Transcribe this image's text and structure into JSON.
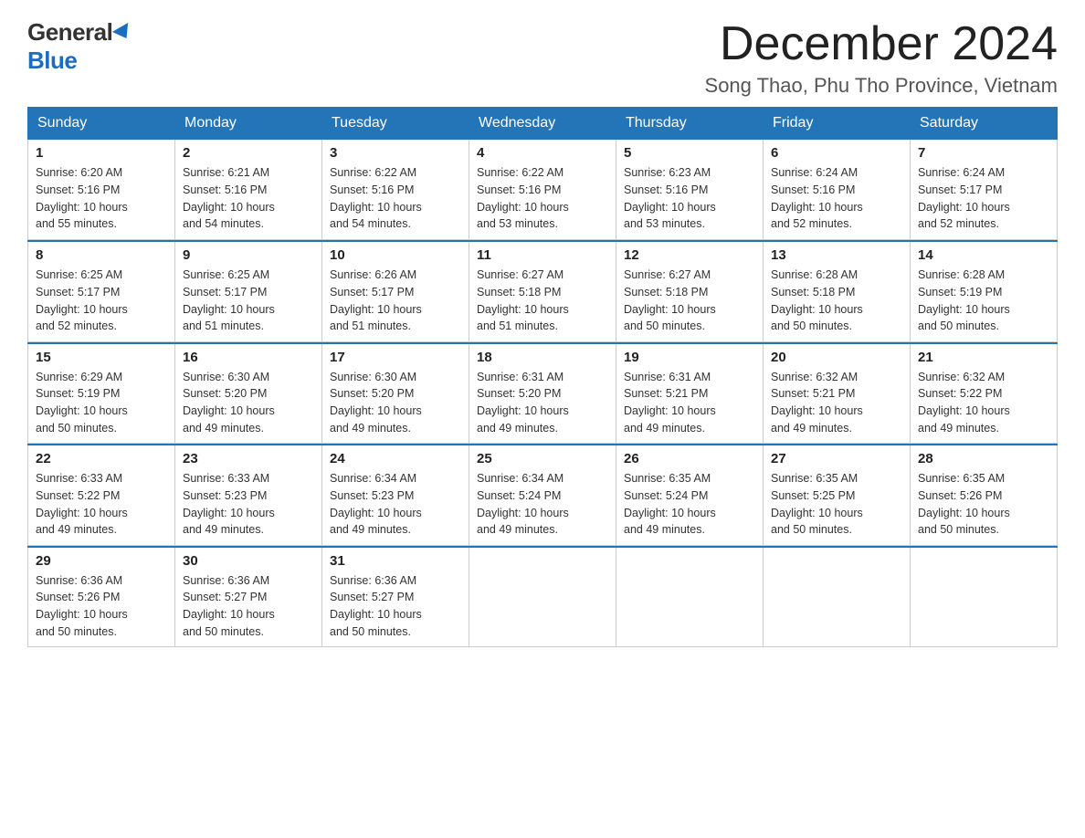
{
  "logo": {
    "general": "General",
    "blue": "Blue"
  },
  "title": "December 2024",
  "subtitle": "Song Thao, Phu Tho Province, Vietnam",
  "weekdays": [
    "Sunday",
    "Monday",
    "Tuesday",
    "Wednesday",
    "Thursday",
    "Friday",
    "Saturday"
  ],
  "weeks": [
    [
      {
        "day": "1",
        "sunrise": "Sunrise: 6:20 AM",
        "sunset": "Sunset: 5:16 PM",
        "daylight": "Daylight: 10 hours",
        "daylight2": "and 55 minutes."
      },
      {
        "day": "2",
        "sunrise": "Sunrise: 6:21 AM",
        "sunset": "Sunset: 5:16 PM",
        "daylight": "Daylight: 10 hours",
        "daylight2": "and 54 minutes."
      },
      {
        "day": "3",
        "sunrise": "Sunrise: 6:22 AM",
        "sunset": "Sunset: 5:16 PM",
        "daylight": "Daylight: 10 hours",
        "daylight2": "and 54 minutes."
      },
      {
        "day": "4",
        "sunrise": "Sunrise: 6:22 AM",
        "sunset": "Sunset: 5:16 PM",
        "daylight": "Daylight: 10 hours",
        "daylight2": "and 53 minutes."
      },
      {
        "day": "5",
        "sunrise": "Sunrise: 6:23 AM",
        "sunset": "Sunset: 5:16 PM",
        "daylight": "Daylight: 10 hours",
        "daylight2": "and 53 minutes."
      },
      {
        "day": "6",
        "sunrise": "Sunrise: 6:24 AM",
        "sunset": "Sunset: 5:16 PM",
        "daylight": "Daylight: 10 hours",
        "daylight2": "and 52 minutes."
      },
      {
        "day": "7",
        "sunrise": "Sunrise: 6:24 AM",
        "sunset": "Sunset: 5:17 PM",
        "daylight": "Daylight: 10 hours",
        "daylight2": "and 52 minutes."
      }
    ],
    [
      {
        "day": "8",
        "sunrise": "Sunrise: 6:25 AM",
        "sunset": "Sunset: 5:17 PM",
        "daylight": "Daylight: 10 hours",
        "daylight2": "and 52 minutes."
      },
      {
        "day": "9",
        "sunrise": "Sunrise: 6:25 AM",
        "sunset": "Sunset: 5:17 PM",
        "daylight": "Daylight: 10 hours",
        "daylight2": "and 51 minutes."
      },
      {
        "day": "10",
        "sunrise": "Sunrise: 6:26 AM",
        "sunset": "Sunset: 5:17 PM",
        "daylight": "Daylight: 10 hours",
        "daylight2": "and 51 minutes."
      },
      {
        "day": "11",
        "sunrise": "Sunrise: 6:27 AM",
        "sunset": "Sunset: 5:18 PM",
        "daylight": "Daylight: 10 hours",
        "daylight2": "and 51 minutes."
      },
      {
        "day": "12",
        "sunrise": "Sunrise: 6:27 AM",
        "sunset": "Sunset: 5:18 PM",
        "daylight": "Daylight: 10 hours",
        "daylight2": "and 50 minutes."
      },
      {
        "day": "13",
        "sunrise": "Sunrise: 6:28 AM",
        "sunset": "Sunset: 5:18 PM",
        "daylight": "Daylight: 10 hours",
        "daylight2": "and 50 minutes."
      },
      {
        "day": "14",
        "sunrise": "Sunrise: 6:28 AM",
        "sunset": "Sunset: 5:19 PM",
        "daylight": "Daylight: 10 hours",
        "daylight2": "and 50 minutes."
      }
    ],
    [
      {
        "day": "15",
        "sunrise": "Sunrise: 6:29 AM",
        "sunset": "Sunset: 5:19 PM",
        "daylight": "Daylight: 10 hours",
        "daylight2": "and 50 minutes."
      },
      {
        "day": "16",
        "sunrise": "Sunrise: 6:30 AM",
        "sunset": "Sunset: 5:20 PM",
        "daylight": "Daylight: 10 hours",
        "daylight2": "and 49 minutes."
      },
      {
        "day": "17",
        "sunrise": "Sunrise: 6:30 AM",
        "sunset": "Sunset: 5:20 PM",
        "daylight": "Daylight: 10 hours",
        "daylight2": "and 49 minutes."
      },
      {
        "day": "18",
        "sunrise": "Sunrise: 6:31 AM",
        "sunset": "Sunset: 5:20 PM",
        "daylight": "Daylight: 10 hours",
        "daylight2": "and 49 minutes."
      },
      {
        "day": "19",
        "sunrise": "Sunrise: 6:31 AM",
        "sunset": "Sunset: 5:21 PM",
        "daylight": "Daylight: 10 hours",
        "daylight2": "and 49 minutes."
      },
      {
        "day": "20",
        "sunrise": "Sunrise: 6:32 AM",
        "sunset": "Sunset: 5:21 PM",
        "daylight": "Daylight: 10 hours",
        "daylight2": "and 49 minutes."
      },
      {
        "day": "21",
        "sunrise": "Sunrise: 6:32 AM",
        "sunset": "Sunset: 5:22 PM",
        "daylight": "Daylight: 10 hours",
        "daylight2": "and 49 minutes."
      }
    ],
    [
      {
        "day": "22",
        "sunrise": "Sunrise: 6:33 AM",
        "sunset": "Sunset: 5:22 PM",
        "daylight": "Daylight: 10 hours",
        "daylight2": "and 49 minutes."
      },
      {
        "day": "23",
        "sunrise": "Sunrise: 6:33 AM",
        "sunset": "Sunset: 5:23 PM",
        "daylight": "Daylight: 10 hours",
        "daylight2": "and 49 minutes."
      },
      {
        "day": "24",
        "sunrise": "Sunrise: 6:34 AM",
        "sunset": "Sunset: 5:23 PM",
        "daylight": "Daylight: 10 hours",
        "daylight2": "and 49 minutes."
      },
      {
        "day": "25",
        "sunrise": "Sunrise: 6:34 AM",
        "sunset": "Sunset: 5:24 PM",
        "daylight": "Daylight: 10 hours",
        "daylight2": "and 49 minutes."
      },
      {
        "day": "26",
        "sunrise": "Sunrise: 6:35 AM",
        "sunset": "Sunset: 5:24 PM",
        "daylight": "Daylight: 10 hours",
        "daylight2": "and 49 minutes."
      },
      {
        "day": "27",
        "sunrise": "Sunrise: 6:35 AM",
        "sunset": "Sunset: 5:25 PM",
        "daylight": "Daylight: 10 hours",
        "daylight2": "and 50 minutes."
      },
      {
        "day": "28",
        "sunrise": "Sunrise: 6:35 AM",
        "sunset": "Sunset: 5:26 PM",
        "daylight": "Daylight: 10 hours",
        "daylight2": "and 50 minutes."
      }
    ],
    [
      {
        "day": "29",
        "sunrise": "Sunrise: 6:36 AM",
        "sunset": "Sunset: 5:26 PM",
        "daylight": "Daylight: 10 hours",
        "daylight2": "and 50 minutes."
      },
      {
        "day": "30",
        "sunrise": "Sunrise: 6:36 AM",
        "sunset": "Sunset: 5:27 PM",
        "daylight": "Daylight: 10 hours",
        "daylight2": "and 50 minutes."
      },
      {
        "day": "31",
        "sunrise": "Sunrise: 6:36 AM",
        "sunset": "Sunset: 5:27 PM",
        "daylight": "Daylight: 10 hours",
        "daylight2": "and 50 minutes."
      },
      null,
      null,
      null,
      null
    ]
  ],
  "colors": {
    "header_bg": "#2475b8",
    "header_text": "#ffffff",
    "border": "#cccccc",
    "text_primary": "#222222",
    "text_secondary": "#333333"
  }
}
